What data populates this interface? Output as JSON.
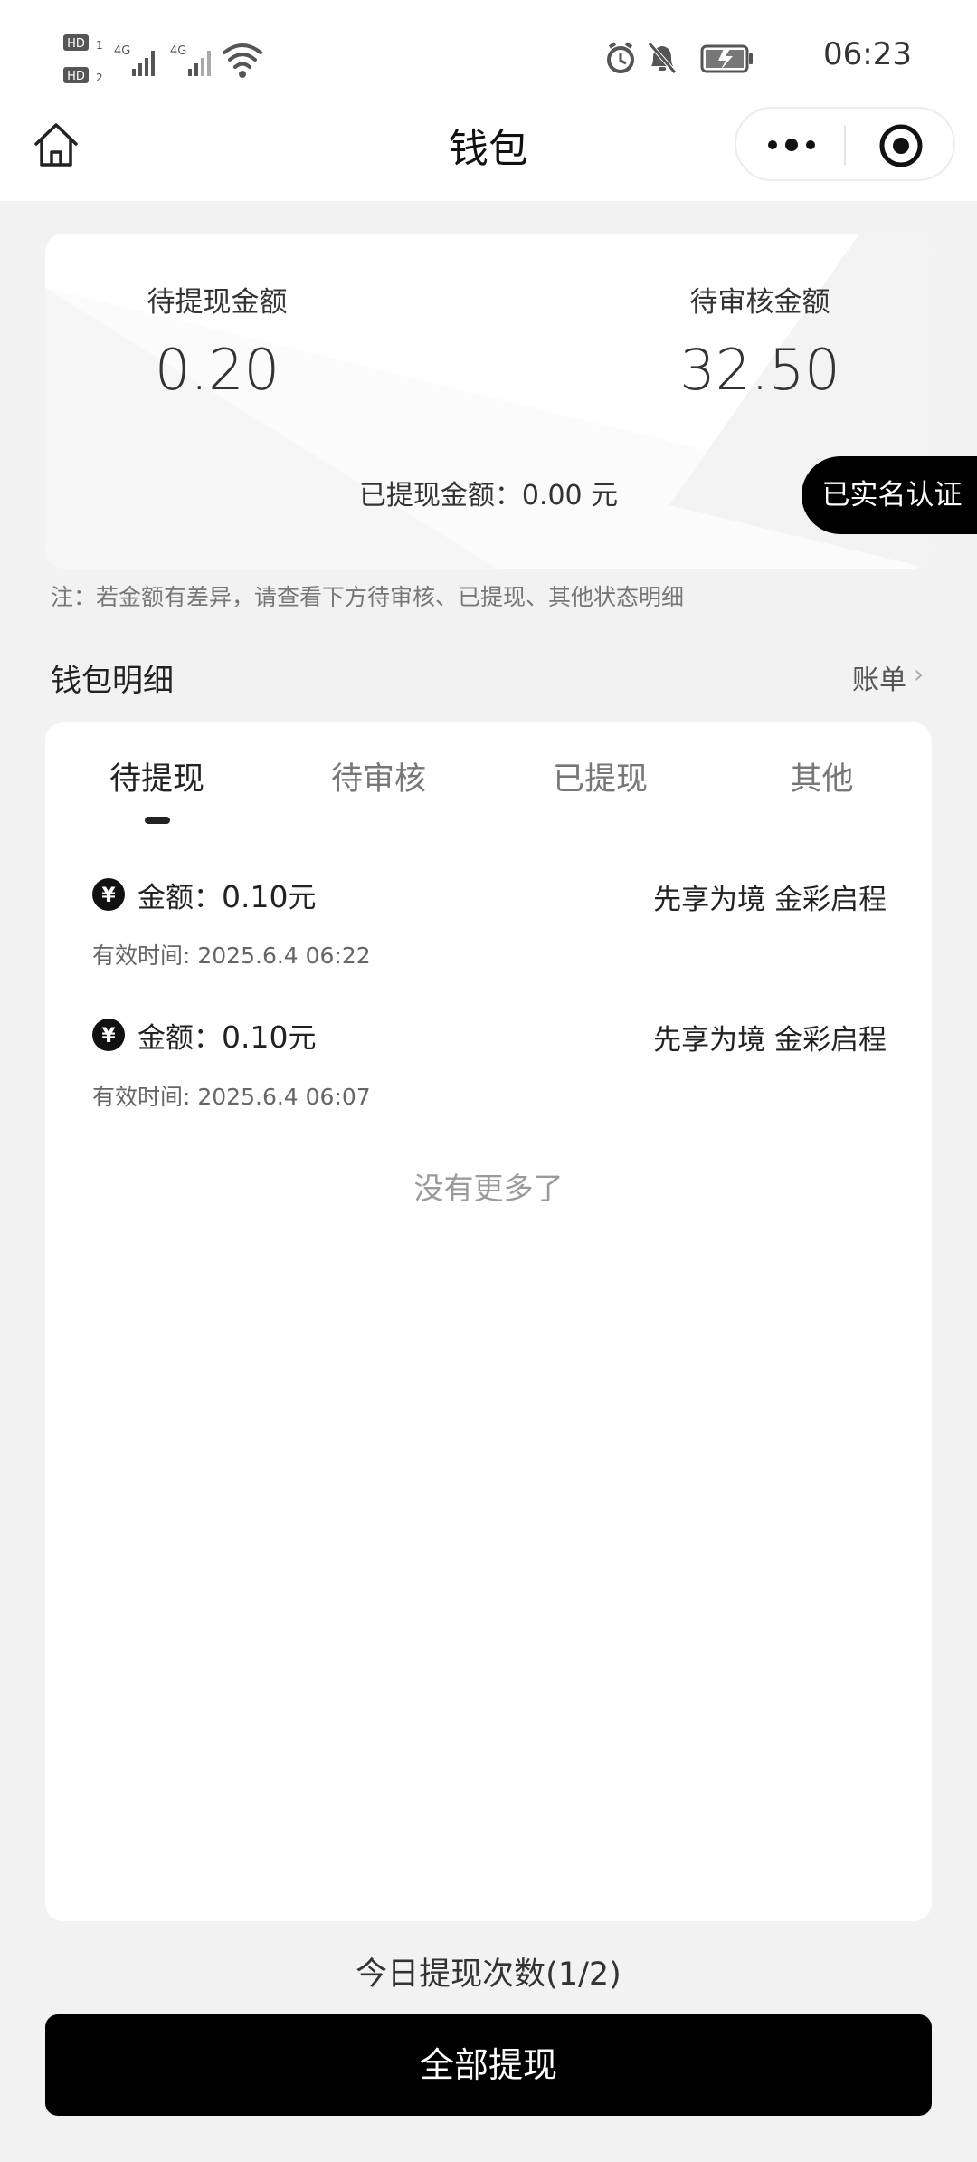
{
  "status_bar": {
    "time": "06:23",
    "sim1_label": "HD",
    "sim1_index": "1",
    "sim2_label": "HD",
    "sim2_index": "2",
    "net1": "4G",
    "net2": "4G",
    "icons": [
      "alarm-icon",
      "bell-off-icon",
      "battery-charging-icon",
      "wifi-icon",
      "signal-icon"
    ]
  },
  "nav": {
    "title": "钱包",
    "icons": [
      "home-icon",
      "more-icon",
      "target-icon"
    ]
  },
  "summary": {
    "pending_withdraw_label": "待提现金额",
    "pending_withdraw_value": "0.20",
    "pending_review_label": "待审核金额",
    "pending_review_value": "32.50",
    "withdrawn_line": "已提现金额：0.00 元",
    "verified_badge": "已实名认证"
  },
  "note": "注：若金额有差异，请查看下方待审核、已提现、其他状态明细",
  "section": {
    "title": "钱包明细",
    "bill_link": "账单",
    "bill_chevron": "›"
  },
  "tabs": [
    {
      "label": "待提现",
      "active": true
    },
    {
      "label": "待审核",
      "active": false
    },
    {
      "label": "已提现",
      "active": false
    },
    {
      "label": "其他",
      "active": false
    }
  ],
  "records": [
    {
      "amount_prefix": "金额：",
      "amount_value": "0.10",
      "amount_unit": "元",
      "title": "先享为境 金彩启程",
      "valid_time": "有效时间: 2025.6.4 06:22"
    },
    {
      "amount_prefix": "金额：",
      "amount_value": "0.10",
      "amount_unit": "元",
      "title": "先享为境 金彩启程",
      "valid_time": "有效时间: 2025.6.4 06:07"
    }
  ],
  "no_more": "没有更多了",
  "daily_count": "今日提现次数(1/2)",
  "withdraw_all_button": "全部提现",
  "colors": {
    "accent": "#000000",
    "page_bg": "#f2f2f2",
    "card_bg": "#ffffff"
  }
}
